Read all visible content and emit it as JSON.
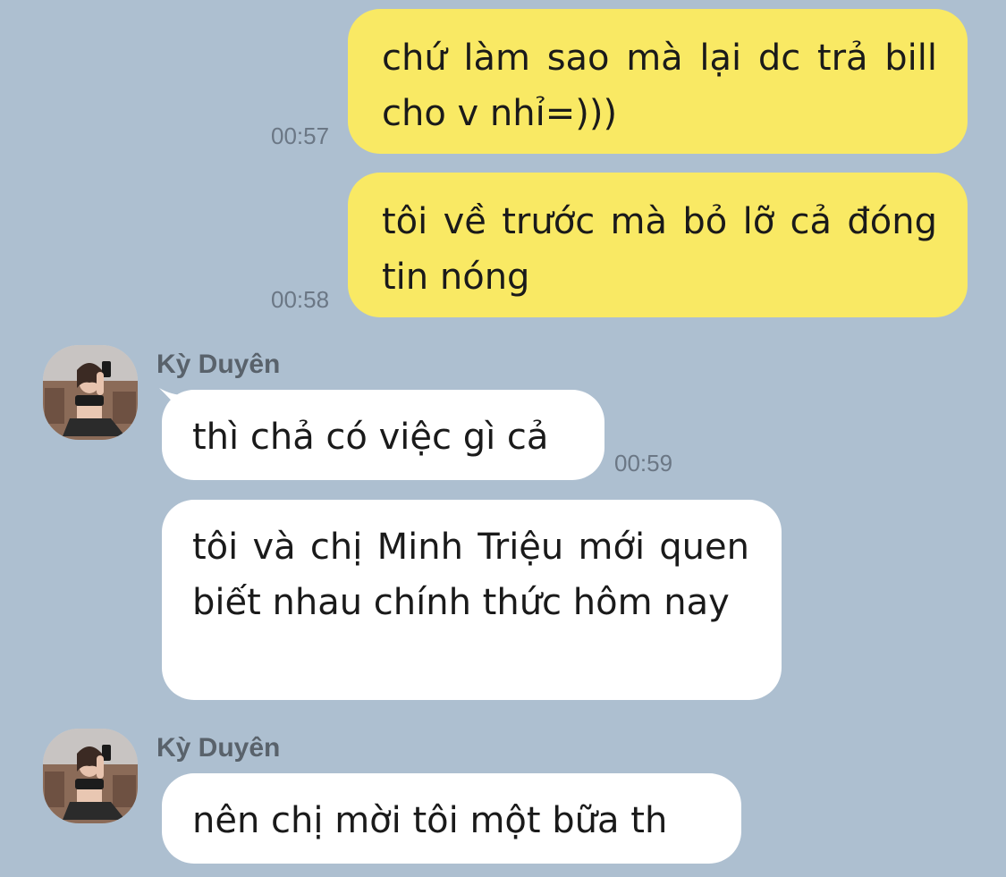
{
  "colors": {
    "background": "#adbfd0",
    "outgoing_bubble": "#f9e964",
    "incoming_bubble": "#ffffff",
    "timestamp": "#6b7785",
    "sender_name": "#59626b"
  },
  "messages": {
    "out1": {
      "text": "chứ làm sao mà lại dc trả bill cho v nhỉ=)))",
      "time": "00:57"
    },
    "out2": {
      "text": "tôi về trước mà bỏ lỡ cả đóng tin nóng",
      "time": "00:58"
    },
    "group1": {
      "sender": "Kỳ Duyên",
      "avatar_icon": "profile-photo",
      "in1": {
        "text": "thì chả có việc gì cả",
        "time": "00:59"
      },
      "in2": {
        "text": "tôi và chị Minh Triệu mới quen biết nhau chính thức hôm nay"
      }
    },
    "group2": {
      "sender": "Kỳ Duyên",
      "avatar_icon": "profile-photo",
      "in3": {
        "text": "nên chị mời tôi một bữa th"
      }
    }
  }
}
